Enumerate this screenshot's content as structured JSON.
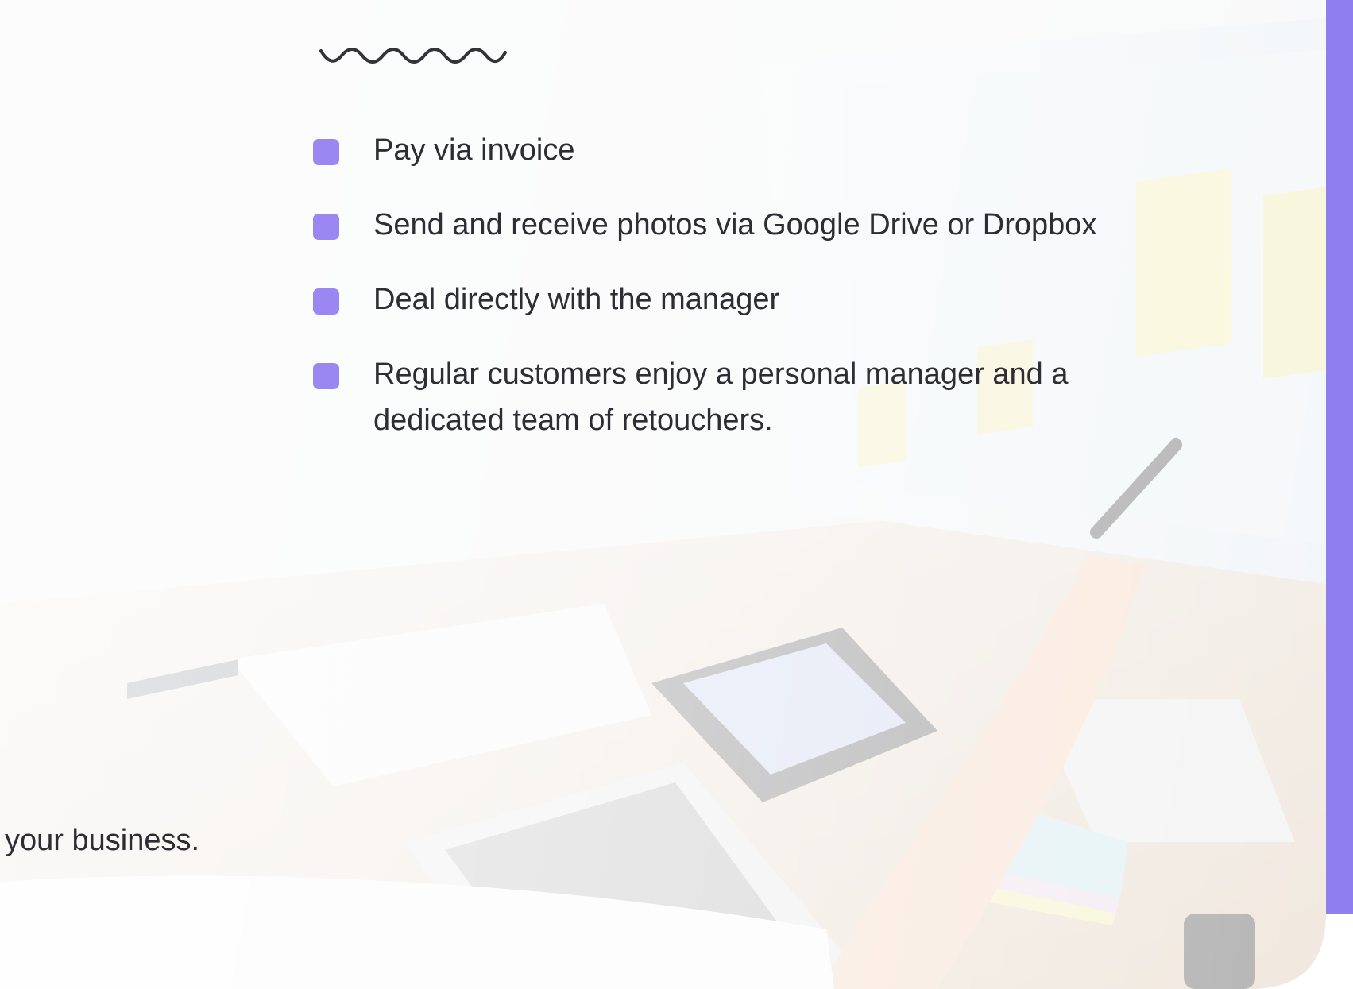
{
  "features": [
    {
      "text": "Pay via invoice"
    },
    {
      "text": "Send and receive photos via Google Drive or Dropbox"
    },
    {
      "text": "Deal directly with the manager"
    },
    {
      "text": "Regular customers enjoy a personal manager and a dedicated team of retouchers."
    }
  ],
  "footer_fragment": "your business.",
  "colors": {
    "accent": "#9b87f2",
    "edge": "#8f7ef0",
    "text": "#2d2d33"
  },
  "icons": {
    "decoration": "squiggle-icon",
    "bullet": "square-bullet-icon"
  }
}
